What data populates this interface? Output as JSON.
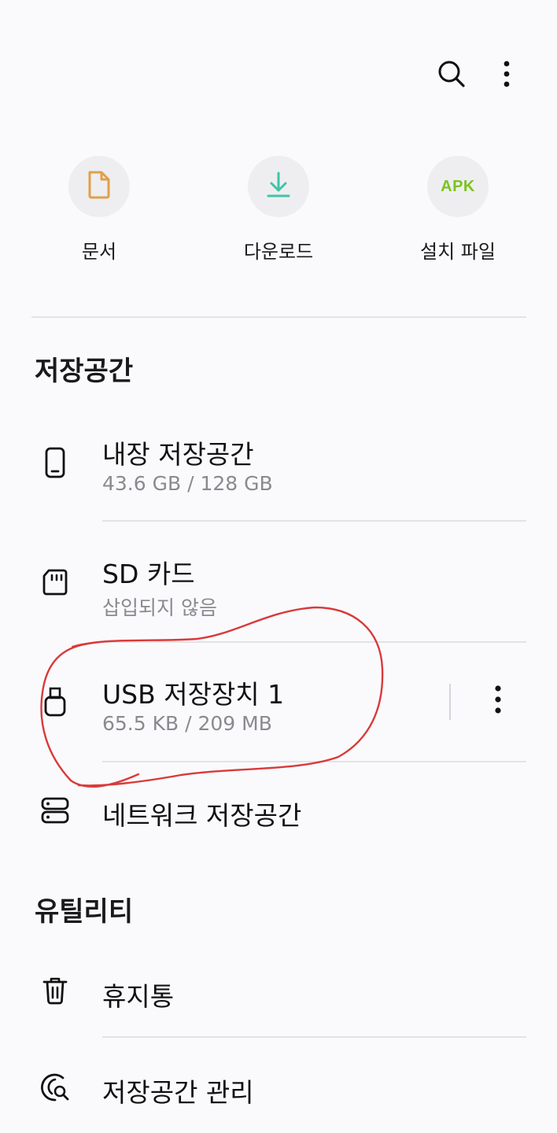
{
  "toolbar": {
    "search_icon": "search-icon",
    "more_icon": "more-vertical-icon"
  },
  "categories": [
    {
      "label": "문서",
      "icon": "document-icon",
      "color": "#e0a04a"
    },
    {
      "label": "다운로드",
      "icon": "download-icon",
      "color": "#3ec4a8"
    },
    {
      "label": "설치 파일",
      "icon": "apk-icon",
      "icon_text": "APK",
      "color": "#7dc31f"
    }
  ],
  "storage": {
    "title": "저장공간",
    "items": [
      {
        "title": "내장 저장공간",
        "subtitle": "43.6 GB / 128 GB",
        "icon": "phone-icon"
      },
      {
        "title": "SD 카드",
        "subtitle": "삽입되지 않음",
        "icon": "sd-card-icon"
      },
      {
        "title": "USB 저장장치 1",
        "subtitle": "65.5 KB / 209 MB",
        "icon": "usb-icon",
        "has_more": true
      },
      {
        "title": "네트워크 저장공간",
        "icon": "network-storage-icon"
      }
    ]
  },
  "utilities": {
    "title": "유틸리티",
    "items": [
      {
        "title": "휴지통",
        "icon": "trash-icon"
      },
      {
        "title": "저장공간 관리",
        "icon": "storage-analysis-icon"
      }
    ]
  },
  "annotation": {
    "color": "#d93a3a"
  }
}
